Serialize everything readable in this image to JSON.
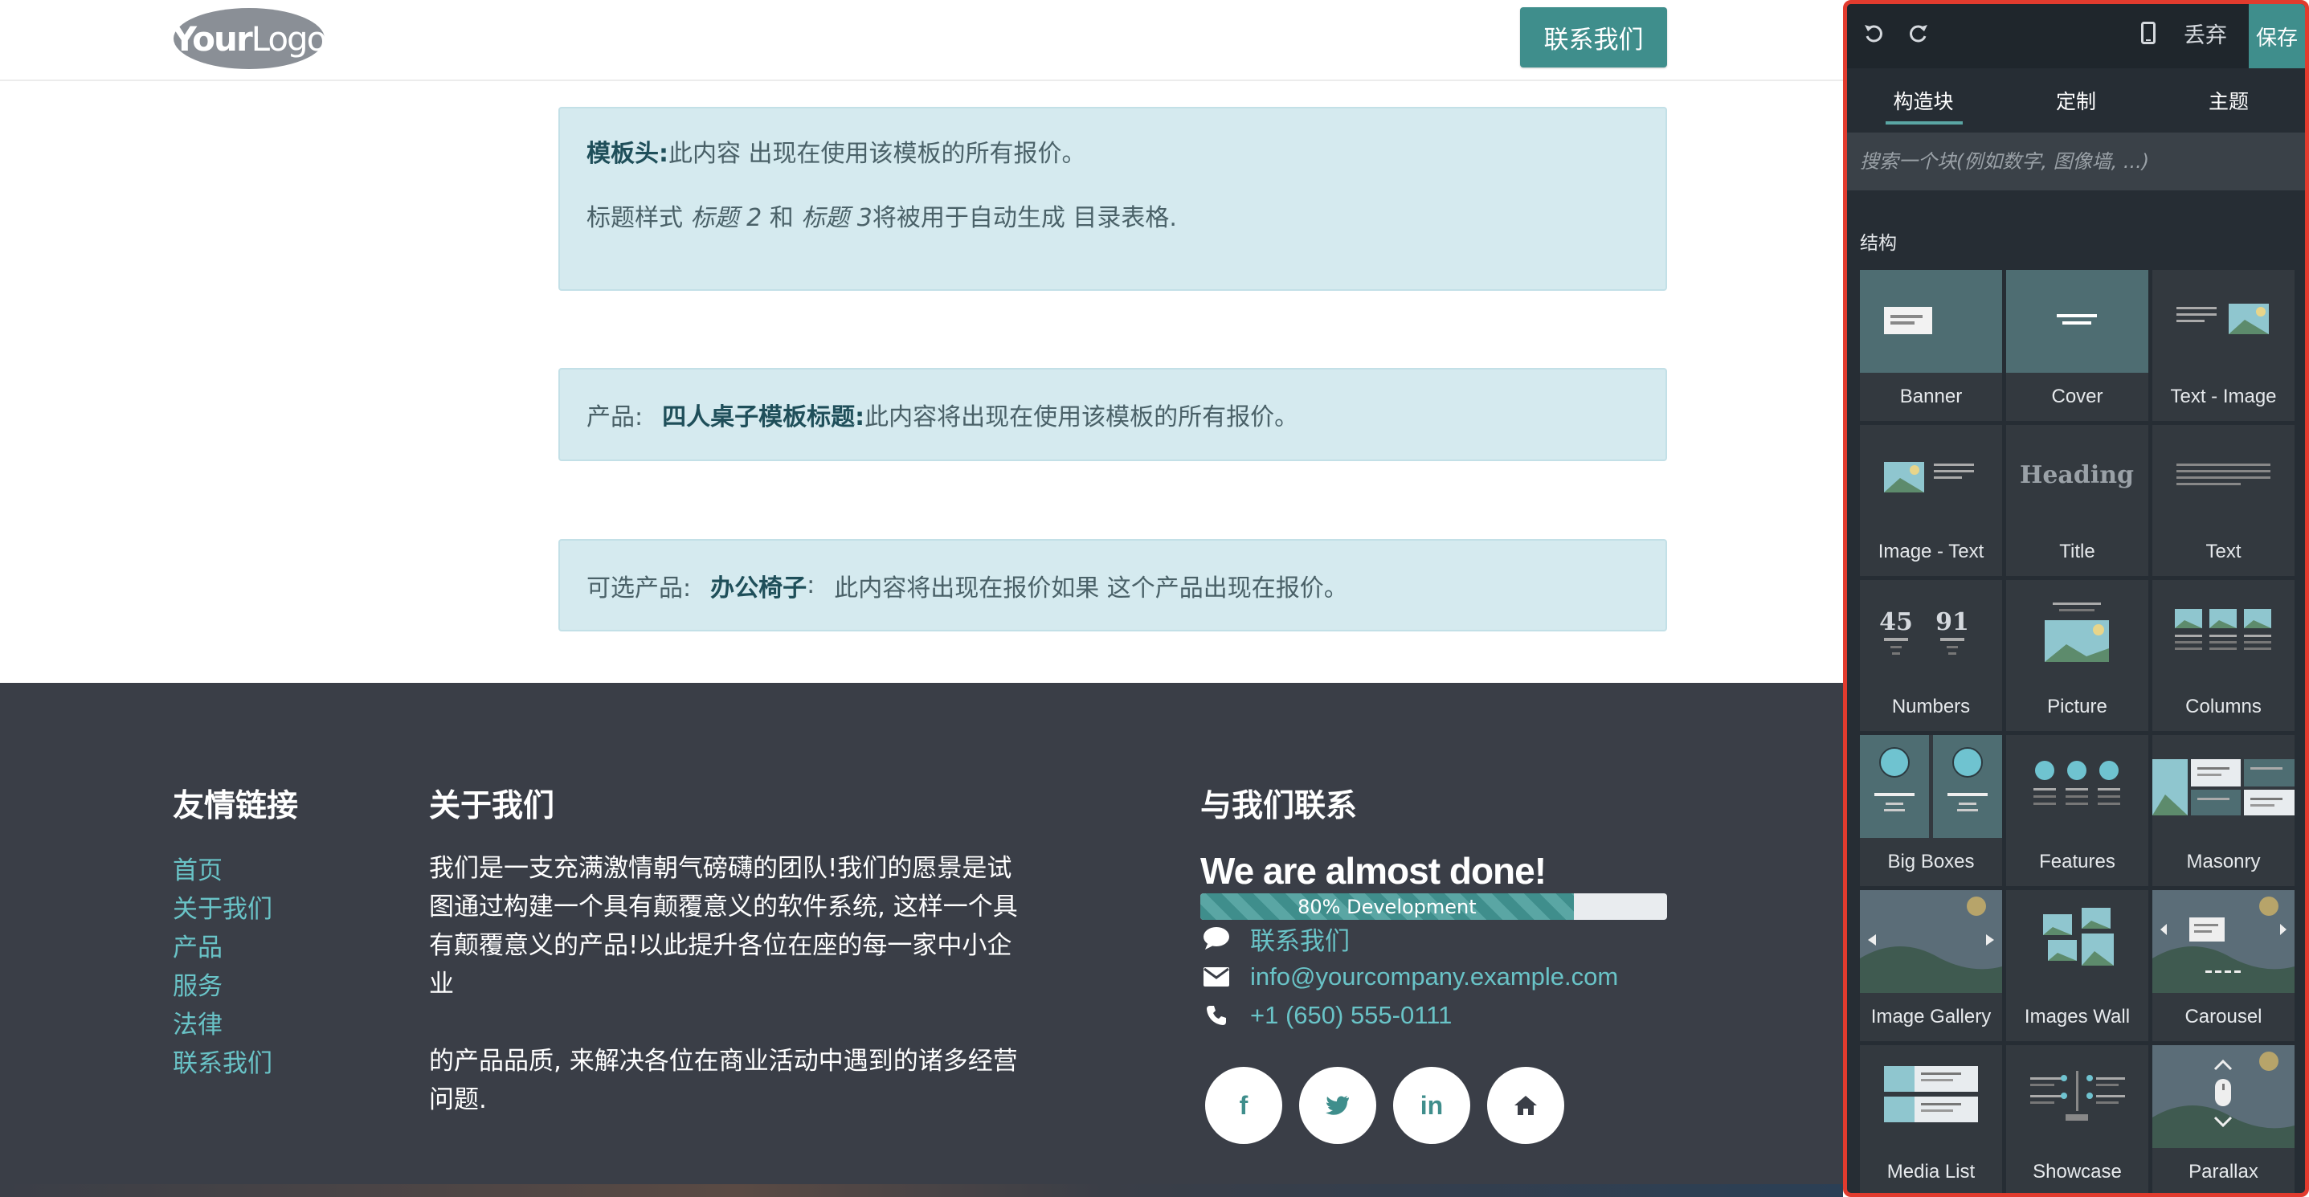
{
  "header": {
    "logo_text_bold": "Your",
    "logo_text": "Logo",
    "cta_label": "联系我们"
  },
  "alerts": {
    "header": {
      "label": "模板头:",
      "text": "此内容 出现在使用该模板的所有报价。",
      "line2_a": "标题样式",
      "line2_i1": "标题 2",
      "line2_b": "和",
      "line2_i2": "标题 3",
      "line2_c": "将被用于自动生成 目录表格."
    },
    "product": {
      "prefix": "产品:",
      "label": "四人桌子模板标题:",
      "text": "此内容将出现在使用该模板的所有报价。"
    },
    "optional": {
      "prefix": "可选产品:",
      "label": "办公椅子",
      "colon": ":",
      "text": "此内容将出现在报价如果 这个产品出现在报价。"
    }
  },
  "footer": {
    "links_title": "友情链接",
    "links": [
      "首页",
      "关于我们",
      "产品",
      "服务",
      "法律",
      "联系我们"
    ],
    "about_title": "关于我们",
    "about_p1": "我们是一支充满激情朝气磅礴的团队!我们的愿景是试图通过构建一个具有颠覆意义的软件系统, 这样一个具有颠覆意义的产品!以此提升各位在座的每一家中小企业",
    "about_p2": "的产品品质, 来解决各位在商业活动中遇到的诸多经营问题.",
    "contact_title": "与我们联系",
    "almost_done": "We are almost done!",
    "progress_label": "80% Development",
    "progress_value": 80,
    "contact_msg": "联系我们",
    "email": "info@yourcompany.example.com",
    "phone": "+1 (650) 555-0111",
    "social": [
      "f",
      "twitter",
      "in",
      "home"
    ]
  },
  "panel": {
    "discard_label": "丢弃",
    "save_label": "保存",
    "tabs": [
      "构造块",
      "定制",
      "主题"
    ],
    "search_placeholder": "搜索一个块(例如数字, 图像墙, ...)",
    "section_label": "结构",
    "blocks": [
      "Banner",
      "Cover",
      "Text - Image",
      "Image - Text",
      "Title",
      "Text",
      "Numbers",
      "Picture",
      "Columns",
      "Big Boxes",
      "Features",
      "Masonry",
      "Image Gallery",
      "Images Wall",
      "Carousel",
      "Media List",
      "Showcase",
      "Parallax"
    ],
    "title_thumb_text": "Heading",
    "numbers_thumb": [
      "45",
      "91"
    ],
    "accent_color": "#3f8e8c",
    "border_color": "#e23b2e"
  }
}
